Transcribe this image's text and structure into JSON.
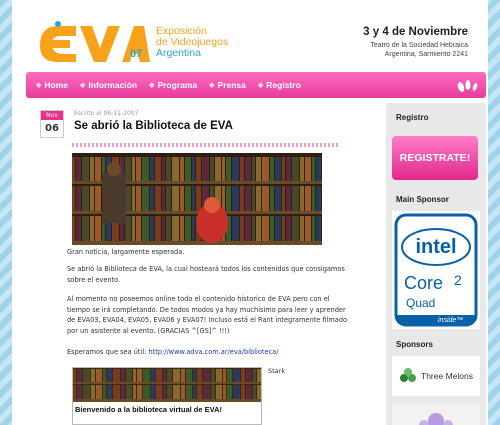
{
  "header": {
    "logo_line1": "Exposición",
    "logo_line2": "de Videojuegos",
    "logo_line3": "Argentina",
    "logo_year": "07",
    "event_date": "3 y 4 de Noviembre",
    "event_place_line1": "Teatro de la Sociedad Hebraica",
    "event_place_line2": "Argentina, Sarmiento 2241"
  },
  "nav": {
    "items": [
      {
        "label": "Home"
      },
      {
        "label": "Información"
      },
      {
        "label": "Programa"
      },
      {
        "label": "Prensa"
      },
      {
        "label": "Registro"
      }
    ]
  },
  "post": {
    "month": "Nov",
    "day": "06",
    "written": "Escrito el 06-11-2007",
    "title": "Se abrió la Biblioteca de EVA",
    "p1": "Gran noticia, largamente esperada.",
    "p2": "Se abrió la Biblioteca de EVA, la cual hosteará todos los contenidos que consigamos sobre el evento.",
    "p3": "Al momento no poseemos online todo el contenido historico de EVA pero con el tiempo se irá completando. De todos modos ya hay muchisimo para leer y aprender de EVA03, EVA04, EVA05, EVA06 y EVA07! Incluso está el Rant integramente filmado por un asistente al evento. (GRACIAS ^[GS]^ !!!)",
    "p4_prefix": "Esperamos que sea útil: ",
    "p4_link": "http://www.adva.com.ar/eva/biblioteca/",
    "thumb_title": "Bienvenido a la biblioteca virtual de EVA!",
    "thumb_caption": "Stark"
  },
  "sidebar": {
    "registro_title": "Registro",
    "registro_button": "REGISTRATE!",
    "main_sponsor_title": "Main Sponsor",
    "intel_word": "intel",
    "intel_core": "Core",
    "intel_two": "2",
    "intel_quad": "Quad",
    "intel_inside": "inside™",
    "sponsors_title": "Sponsors",
    "sponsor_name": "Three Melons"
  },
  "colors": {
    "accent_pink": "#e8308e",
    "logo_orange": "#f7a21b",
    "logo_blue": "#2aa6d9",
    "intel_blue": "#0860a8"
  }
}
